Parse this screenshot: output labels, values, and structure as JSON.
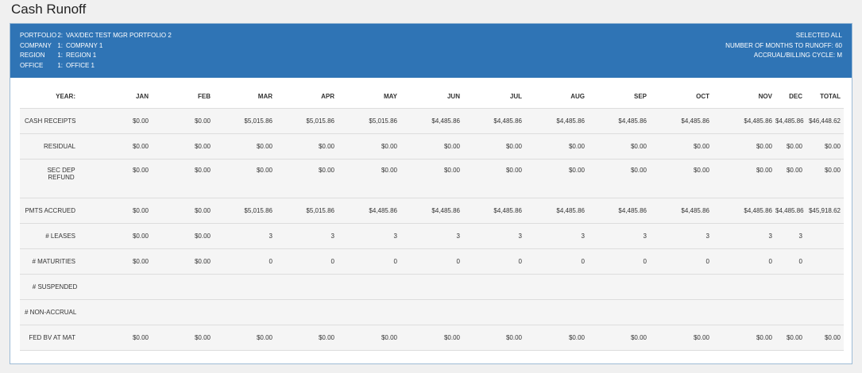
{
  "page": {
    "title": "Cash Runoff"
  },
  "header": {
    "left": [
      {
        "key": "PORTFOLIO",
        "num": "2:",
        "value": "VAX/DEC TEST MGR PORTFOLIO 2"
      },
      {
        "key": "COMPANY",
        "num": "1:",
        "value": "COMPANY 1"
      },
      {
        "key": "REGION",
        "num": "1:",
        "value": "REGION 1"
      },
      {
        "key": "OFFICE",
        "num": "1:",
        "value": "OFFICE 1"
      }
    ],
    "right": [
      "SELECTED ALL",
      "NUMBER OF MONTHS TO RUNOFF: 60",
      "ACCRUAL/BILLING CYCLE: M"
    ]
  },
  "table": {
    "columns": [
      "YEAR:",
      "JAN",
      "FEB",
      "MAR",
      "APR",
      "MAY",
      "JUN",
      "JUL",
      "AUG",
      "SEP",
      "OCT",
      "NOV",
      "DEC",
      "TOTAL"
    ],
    "rows": [
      {
        "label": "CASH RECEIPTS",
        "values": [
          "$0.00",
          "$0.00",
          "$5,015.86",
          "$5,015.86",
          "$5,015.86",
          "$4,485.86",
          "$4,485.86",
          "$4,485.86",
          "$4,485.86",
          "$4,485.86",
          "$4,485.86",
          "$4,485.86",
          "$46,448.62"
        ]
      },
      {
        "label": "RESIDUAL",
        "values": [
          "$0.00",
          "$0.00",
          "$0.00",
          "$0.00",
          "$0.00",
          "$0.00",
          "$0.00",
          "$0.00",
          "$0.00",
          "$0.00",
          "$0.00",
          "$0.00",
          "$0.00"
        ]
      },
      {
        "label": "SEC DEP REFUND",
        "values": [
          "$0.00",
          "$0.00",
          "$0.00",
          "$0.00",
          "$0.00",
          "$0.00",
          "$0.00",
          "$0.00",
          "$0.00",
          "$0.00",
          "$0.00",
          "$0.00",
          "$0.00"
        ]
      },
      {
        "label": "PMTS ACCRUED",
        "values": [
          "$0.00",
          "$0.00",
          "$5,015.86",
          "$5,015.86",
          "$4,485.86",
          "$4,485.86",
          "$4,485.86",
          "$4,485.86",
          "$4,485.86",
          "$4,485.86",
          "$4,485.86",
          "$4,485.86",
          "$45,918.62"
        ]
      },
      {
        "label": "# LEASES",
        "values": [
          "$0.00",
          "$0.00",
          "3",
          "3",
          "3",
          "3",
          "3",
          "3",
          "3",
          "3",
          "3",
          "3",
          ""
        ]
      },
      {
        "label": "# MATURITIES",
        "values": [
          "$0.00",
          "$0.00",
          "0",
          "0",
          "0",
          "0",
          "0",
          "0",
          "0",
          "0",
          "0",
          "0",
          ""
        ]
      },
      {
        "label": "# SUSPENDED",
        "values": [
          "",
          "",
          "",
          "",
          "",
          "",
          "",
          "",
          "",
          "",
          "",
          "",
          ""
        ]
      },
      {
        "label": "# NON-ACCRUAL",
        "values": [
          "",
          "",
          "",
          "",
          "",
          "",
          "",
          "",
          "",
          "",
          "",
          "",
          ""
        ]
      },
      {
        "label": "FED BV AT MAT",
        "values": [
          "$0.00",
          "$0.00",
          "$0.00",
          "$0.00",
          "$0.00",
          "$0.00",
          "$0.00",
          "$0.00",
          "$0.00",
          "$0.00",
          "$0.00",
          "$0.00",
          "$0.00"
        ]
      }
    ]
  }
}
